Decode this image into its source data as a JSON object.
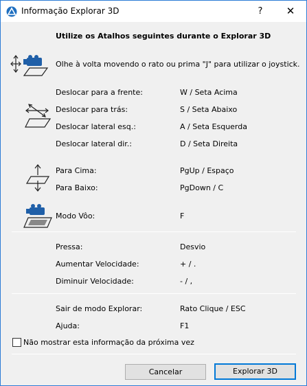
{
  "window": {
    "title": "Informação Explorar 3D",
    "help": "?",
    "close": "✕"
  },
  "heading": "Utilize os Atalhos seguintes durante o Explorar 3D",
  "intro": "Olhe à volta movendo o rato ou prima \"J\" para utilizar o joystick.",
  "movement": [
    {
      "action": "Deslocar para a frente:",
      "key": "W / Seta Acima"
    },
    {
      "action": "Deslocar para trás:",
      "key": "S / Seta Abaixo"
    },
    {
      "action": "Deslocar lateral esq.:",
      "key": "A / Seta Esquerda"
    },
    {
      "action": "Deslocar lateral dir.:",
      "key": "D / Seta Direita"
    }
  ],
  "vertical": [
    {
      "action": "Para Cima:",
      "key": "PgUp / Espaço"
    },
    {
      "action": "Para Baixo:",
      "key": "PgDown / C"
    }
  ],
  "fly": {
    "action": "Modo Vôo:",
    "key": "F"
  },
  "speed": [
    {
      "action": "Pressa:",
      "key": "Desvio"
    },
    {
      "action": "Aumentar Velocidade:",
      "key": "+ / ."
    },
    {
      "action": "Diminuir Velocidade:",
      "key": "- / ,"
    }
  ],
  "misc": [
    {
      "action": "Sair de modo Explorar:",
      "key": "Rato Clique / ESC"
    },
    {
      "action": "Ajuda:",
      "key": "F1"
    }
  ],
  "checkbox_label": "Não mostrar esta informação da próxima vez",
  "buttons": {
    "cancel": "Cancelar",
    "explore": "Explorar 3D"
  },
  "colors": {
    "accent": "#0078d7",
    "icon_blue": "#1f5fa8"
  }
}
